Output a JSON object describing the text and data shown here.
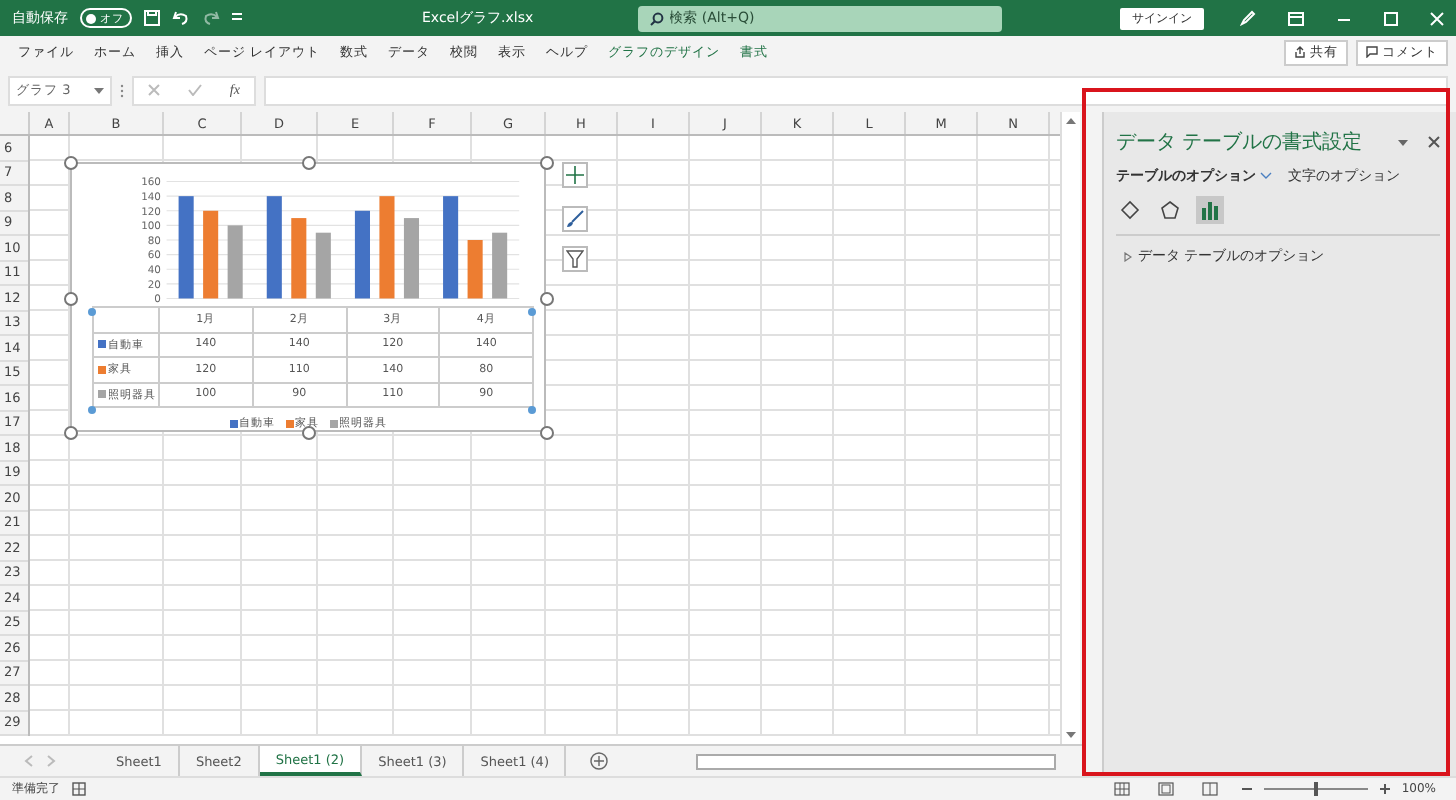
{
  "title_bar": {
    "autosave_label": "自動保存",
    "autosave": {
      "on": false,
      "label": "オフ"
    },
    "file_name": "Excelグラフ.xlsx",
    "search": {
      "placeholder": "検索 (Alt+Q)"
    },
    "sign_in": "サインイン"
  },
  "ribbon_tabs": [
    {
      "label": "ファイル",
      "kind": "normal"
    },
    {
      "label": "ホーム",
      "kind": "normal"
    },
    {
      "label": "挿入",
      "kind": "normal"
    },
    {
      "label": "ページ レイアウト",
      "kind": "normal"
    },
    {
      "label": "数式",
      "kind": "normal"
    },
    {
      "label": "データ",
      "kind": "normal"
    },
    {
      "label": "校閲",
      "kind": "normal"
    },
    {
      "label": "表示",
      "kind": "normal"
    },
    {
      "label": "ヘルプ",
      "kind": "normal"
    },
    {
      "label": "グラフのデザイン",
      "kind": "context"
    },
    {
      "label": "書式",
      "kind": "context"
    }
  ],
  "share_button": "共有",
  "comment_button": "コメント",
  "formula_bar": {
    "name_box": "グラフ 3",
    "function_label": "fx"
  },
  "columns": [
    "A",
    "B",
    "C",
    "D",
    "E",
    "F",
    "G",
    "H",
    "I",
    "J",
    "K",
    "L",
    "M",
    "N"
  ],
  "rows": [
    "6",
    "7",
    "8",
    "9",
    "10",
    "11",
    "12",
    "13",
    "14",
    "15",
    "16",
    "17",
    "18",
    "19",
    "20",
    "21",
    "22",
    "23",
    "24",
    "25",
    "26",
    "27",
    "28",
    "29"
  ],
  "chart": {
    "chart_data": {
      "type": "bar",
      "categories": [
        "1月",
        "2月",
        "3月",
        "4月"
      ],
      "yticks": [
        0,
        20,
        40,
        60,
        80,
        100,
        120,
        140,
        160
      ],
      "ylim": [
        0,
        160
      ],
      "grid": true,
      "legend": "bottom",
      "series": [
        {
          "name": "自動車",
          "color": "#4472c4",
          "values": [
            140,
            140,
            120,
            140
          ]
        },
        {
          "name": "家具",
          "color": "#ed7d31",
          "values": [
            120,
            110,
            140,
            80
          ]
        },
        {
          "name": "照明器具",
          "color": "#a5a5a5",
          "values": [
            100,
            90,
            110,
            90
          ]
        }
      ]
    },
    "data_table": {
      "rows": [
        {
          "name": "自動車",
          "color": "#4472c4",
          "values": [
            "140",
            "140",
            "120",
            "140"
          ]
        },
        {
          "name": "家具",
          "color": "#ed7d31",
          "values": [
            "120",
            "110",
            "140",
            "80"
          ]
        },
        {
          "name": "照明器具",
          "color": "#a5a5a5",
          "values": [
            "100",
            "90",
            "110",
            "90"
          ]
        }
      ]
    }
  },
  "pane": {
    "title": "データ テーブルの書式設定",
    "tabs": [
      {
        "label": "テーブルのオプション",
        "selected": true
      },
      {
        "label": "文字のオプション",
        "selected": false
      }
    ],
    "icons": [
      {
        "kind": "fill",
        "selected": false
      },
      {
        "kind": "shape",
        "selected": false
      },
      {
        "kind": "chart",
        "selected": true
      }
    ],
    "sections": [
      {
        "label": "データ テーブルのオプション",
        "expanded": false
      }
    ]
  },
  "sheet_tabs": [
    {
      "label": "Sheet1",
      "selected": false
    },
    {
      "label": "Sheet2",
      "selected": false
    },
    {
      "label": "Sheet1 (2)",
      "selected": true
    },
    {
      "label": "Sheet1 (3)",
      "selected": false
    },
    {
      "label": "Sheet1 (4)",
      "selected": false
    }
  ],
  "status_bar": {
    "text": "準備完了",
    "zoom": {
      "level": 0.5,
      "reading": "100%"
    }
  }
}
